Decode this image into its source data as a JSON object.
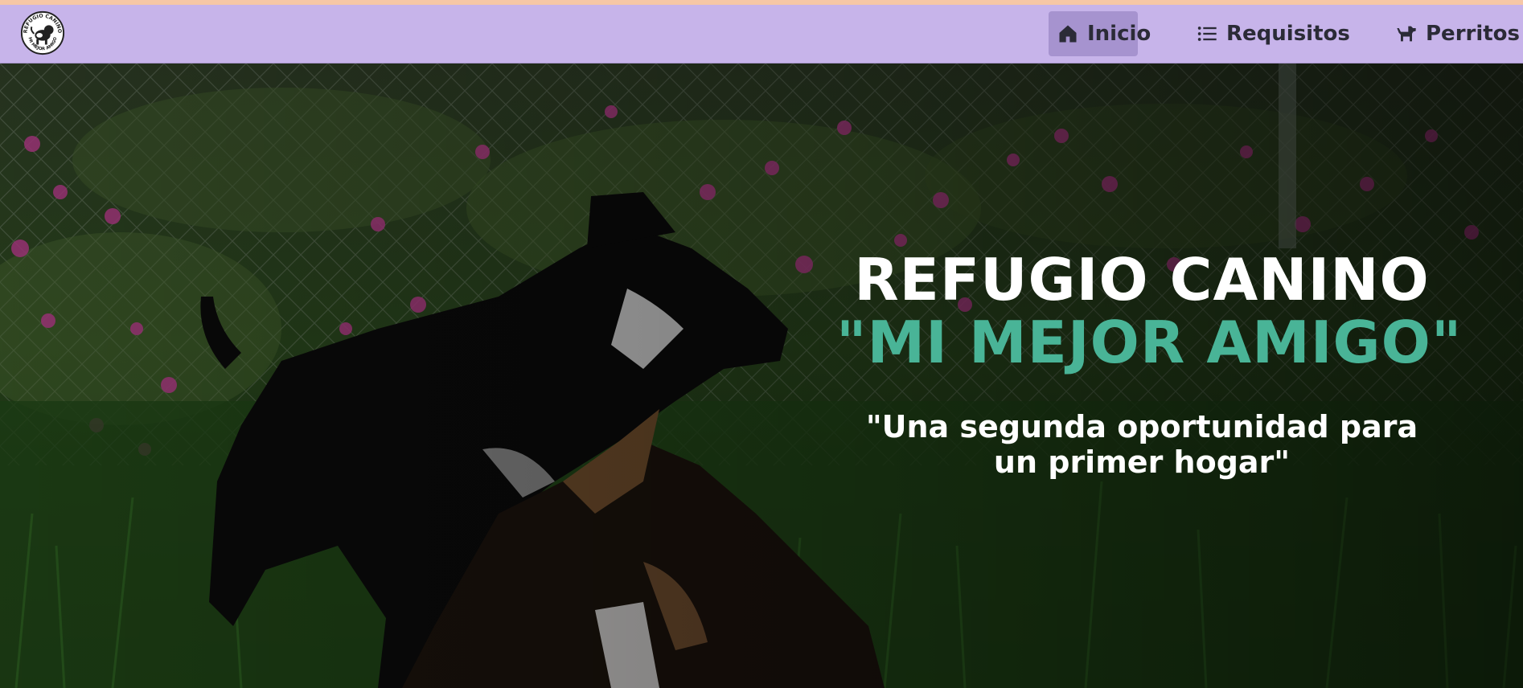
{
  "nav": {
    "logo_icon": "refugio-canino-logo",
    "logo_text_top": "REFUGIO CANINO",
    "logo_text_bottom": "MI MEJOR AMIGO",
    "items": [
      {
        "label": "Inicio",
        "icon": "home-icon",
        "active": true
      },
      {
        "label": "Requisitos",
        "icon": "list-icon",
        "active": false
      },
      {
        "label": "Perritos",
        "icon": "dog-icon",
        "active": false
      }
    ],
    "bg_color": "#c7b4ea",
    "active_color": "#a693cf"
  },
  "hero": {
    "title_line1": "REFUGIO CANINO",
    "title_line2": "\"MI MEJOR AMIGO\"",
    "tagline": "\"Una segunda oportunidad para un primer hogar\"",
    "accent_color": "#49b497"
  }
}
